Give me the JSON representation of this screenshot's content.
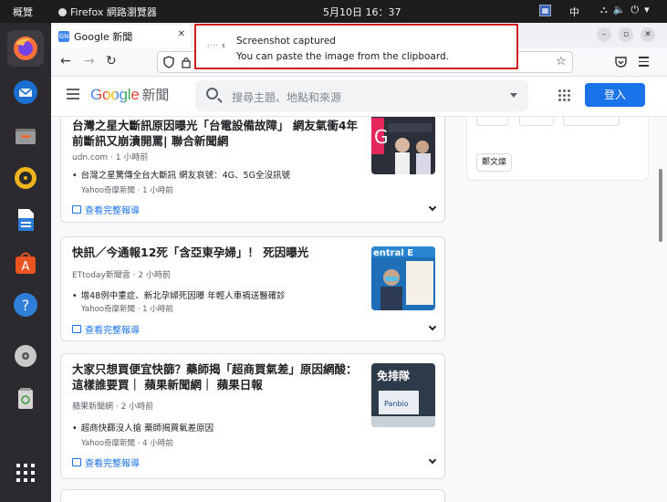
{
  "system_bar": {
    "activities": "概覽",
    "app_menu": "Firefox 網路瀏覽器",
    "clock": "5月10日  16：37",
    "language": "中"
  },
  "dock": {
    "items": [
      "firefox-icon",
      "thunderbird-icon",
      "files-icon",
      "rhythmbox-icon",
      "libreoffice-writer-icon",
      "software-center-icon",
      "help-icon",
      "dvd-drive-icon",
      "trash-icon",
      "show-apps-icon"
    ]
  },
  "browser": {
    "tab_title": "Google 新聞",
    "tab_favicon": "GN"
  },
  "notification": {
    "title": "Screenshot captured",
    "body": "You can paste the image from the clipboard.",
    "icon_text": ":··· ɛ"
  },
  "google_news": {
    "logo": {
      "google": "Google",
      "news": "新聞"
    },
    "search_placeholder": "搜尋主題、地點和來源",
    "sign_in": "登入",
    "side_chip": "鄭文燦",
    "full_coverage_label": "查看完整報導",
    "articles": [
      {
        "title": "台灣之星大斷訊原因曝光「台電設備故障」 網友氣衝4年前斷訊又崩潰開罵| 聯合新聞網",
        "source_time": "udn.com · 1 小時前",
        "sub_title": "台灣之星驚傳全台大斷訊 網友哀號：4G、5G全沒訊號",
        "sub_meta": "Yahoo奇摩新聞 · 1 小時前"
      },
      {
        "title": "快訊／今通報12死「含亞東孕婦」！ 死因曝光",
        "source_time": "ETtoday新聞雲 · 2 小時前",
        "sub_title": "增48例中重症、新北孕婦死因曝 年輕人車禍送醫確診",
        "sub_meta": "Yahoo奇摩新聞 · 1 小時前"
      },
      {
        "title": "大家只想買便宜快篩？藥師揭「超商買氣差」原因網酸：這樣誰要買｜ 蘋果新聞網｜ 蘋果日報",
        "source_time": "蘋果新聞網 · 2 小時前",
        "sub_title": "超商快篩沒人搶 藥師揭買氣差原因",
        "sub_meta": "Yahoo奇摩新聞 · 4 小時前"
      }
    ]
  }
}
